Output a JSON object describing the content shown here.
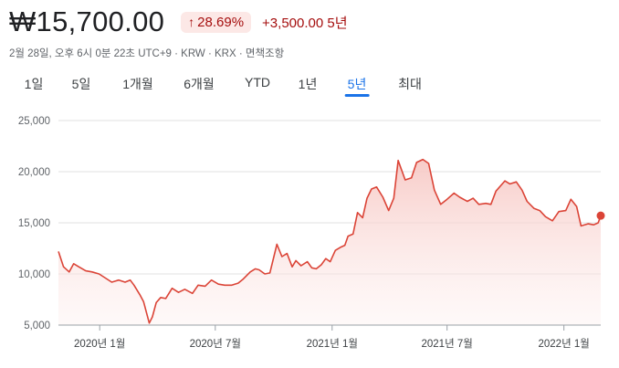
{
  "header": {
    "price": "₩15,700.00",
    "change_percent": "28.69%",
    "change_abs": "+3,500.00",
    "change_period": "5년",
    "meta": "2월 28일, 오후 6시 0분 22초 UTC+9 · KRW · KRX · 면책조항"
  },
  "ranges": [
    {
      "label": "1일"
    },
    {
      "label": "5일"
    },
    {
      "label": "1개월"
    },
    {
      "label": "6개월"
    },
    {
      "label": "YTD"
    },
    {
      "label": "1년"
    },
    {
      "label": "5년"
    },
    {
      "label": "최대"
    }
  ],
  "active_range": "5년",
  "colors": {
    "line": "#db4437",
    "fill": "#f9d6d3",
    "grid": "#e0e0e0",
    "active": "#1a73e8",
    "negative": "#a50e0e"
  },
  "chart_data": {
    "type": "area",
    "title": "",
    "xlabel": "",
    "ylabel": "",
    "ylim": [
      5000,
      25000
    ],
    "yticks": [
      5000,
      10000,
      15000,
      20000,
      25000
    ],
    "ytick_labels": [
      "5,000",
      "10,000",
      "15,000",
      "20,000",
      "25,000"
    ],
    "xticks": [
      {
        "date": "2020-01-01",
        "label": "2020년 1월"
      },
      {
        "date": "2020-07-01",
        "label": "2020년 7월"
      },
      {
        "date": "2021-01-01",
        "label": "2021년 1월"
      },
      {
        "date": "2021-07-01",
        "label": "2021년 7월"
      },
      {
        "date": "2022-01-01",
        "label": "2022년 1월"
      }
    ],
    "grid": true,
    "series": [
      {
        "x": [
          "2019-10-28",
          "2019-11-05",
          "2019-11-14",
          "2019-11-21",
          "2019-11-29",
          "2019-12-10",
          "2019-12-20",
          "2019-12-31",
          "2020-01-10",
          "2020-01-20",
          "2020-01-31",
          "2020-02-10",
          "2020-02-18",
          "2020-02-24",
          "2020-03-04",
          "2020-03-10",
          "2020-03-19",
          "2020-03-24",
          "2020-03-30",
          "2020-04-06",
          "2020-04-14",
          "2020-04-24",
          "2020-05-04",
          "2020-05-14",
          "2020-05-26",
          "2020-06-04",
          "2020-06-15",
          "2020-06-25",
          "2020-07-06",
          "2020-07-16",
          "2020-07-27",
          "2020-08-06",
          "2020-08-14",
          "2020-08-25",
          "2020-09-02",
          "2020-09-08",
          "2020-09-17",
          "2020-09-25",
          "2020-10-06",
          "2020-10-14",
          "2020-10-22",
          "2020-10-30",
          "2020-11-05",
          "2020-11-13",
          "2020-11-23",
          "2020-11-30",
          "2020-12-07",
          "2020-12-15",
          "2020-12-22",
          "2020-12-29",
          "2021-01-06",
          "2021-01-14",
          "2021-01-21",
          "2021-01-26",
          "2021-02-03",
          "2021-02-10",
          "2021-02-18",
          "2021-02-25",
          "2021-03-04",
          "2021-03-12",
          "2021-03-22",
          "2021-03-31",
          "2021-04-08",
          "2021-04-15",
          "2021-04-26",
          "2021-05-06",
          "2021-05-14",
          "2021-05-24",
          "2021-06-02",
          "2021-06-11",
          "2021-06-21",
          "2021-07-01",
          "2021-07-12",
          "2021-07-21",
          "2021-08-02",
          "2021-08-11",
          "2021-08-20",
          "2021-08-31",
          "2021-09-08",
          "2021-09-16",
          "2021-09-30",
          "2021-10-08",
          "2021-10-18",
          "2021-10-27",
          "2021-11-04",
          "2021-11-15",
          "2021-11-24",
          "2021-12-03",
          "2021-12-14",
          "2021-12-24",
          "2022-01-04",
          "2022-01-12",
          "2022-01-21",
          "2022-01-28",
          "2022-02-08",
          "2022-02-17",
          "2022-02-24",
          "2022-02-28"
        ],
        "values": [
          12200,
          10700,
          10200,
          11000,
          10700,
          10300,
          10200,
          10000,
          9600,
          9200,
          9400,
          9200,
          9400,
          8900,
          8000,
          7300,
          5200,
          5800,
          7200,
          7700,
          7600,
          8600,
          8200,
          8500,
          8100,
          8900,
          8800,
          9400,
          9000,
          8900,
          8900,
          9100,
          9500,
          10200,
          10500,
          10400,
          10000,
          10100,
          12900,
          11700,
          12000,
          10700,
          11300,
          10800,
          11200,
          10600,
          10500,
          10900,
          11500,
          11200,
          12300,
          12600,
          12800,
          13700,
          13900,
          16000,
          15500,
          17400,
          18300,
          18500,
          17500,
          16200,
          17400,
          21100,
          19200,
          19400,
          20900,
          21200,
          20800,
          18200,
          16800,
          17300,
          17900,
          17500,
          17100,
          17400,
          16800,
          16900,
          16800,
          18100,
          19100,
          18800,
          19000,
          18200,
          17100,
          16400,
          16200,
          15600,
          15200,
          16100,
          16200,
          17300,
          16600,
          14700,
          14900,
          14800,
          15000,
          15700
        ]
      }
    ],
    "last_value": 15700
  }
}
